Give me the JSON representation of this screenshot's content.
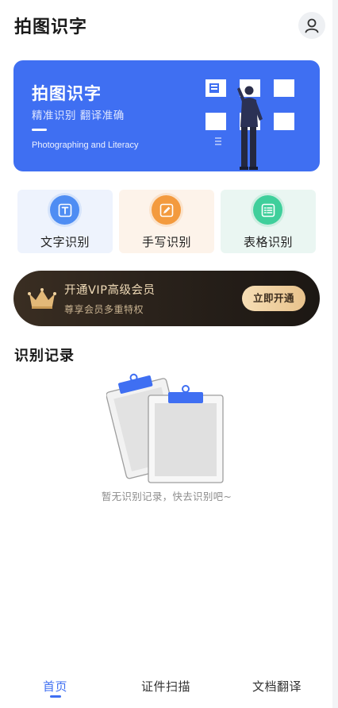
{
  "header": {
    "title": "拍图识字",
    "avatar_icon": "user-icon"
  },
  "banner": {
    "title": "拍图识字",
    "subtitle": "精准识别 翻译准确",
    "english": "Photographing and Literacy",
    "bg_color": "#3f6ff2"
  },
  "features": [
    {
      "label": "文字识别",
      "icon": "text-t-icon"
    },
    {
      "label": "手写识别",
      "icon": "pen-icon"
    },
    {
      "label": "表格识别",
      "icon": "table-icon"
    }
  ],
  "vip": {
    "title": "开通VIP高级会员",
    "subtitle": "尊享会员多重特权",
    "button": "立即开通",
    "icon": "crown-icon"
  },
  "records": {
    "title": "识别记录",
    "empty_text": "暂无识别记录，快去识别吧~"
  },
  "tabs": [
    {
      "label": "首页",
      "active": true
    },
    {
      "label": "证件扫描",
      "active": false
    },
    {
      "label": "文档翻译",
      "active": false
    }
  ],
  "colors": {
    "accent": "#3f6ff2"
  }
}
